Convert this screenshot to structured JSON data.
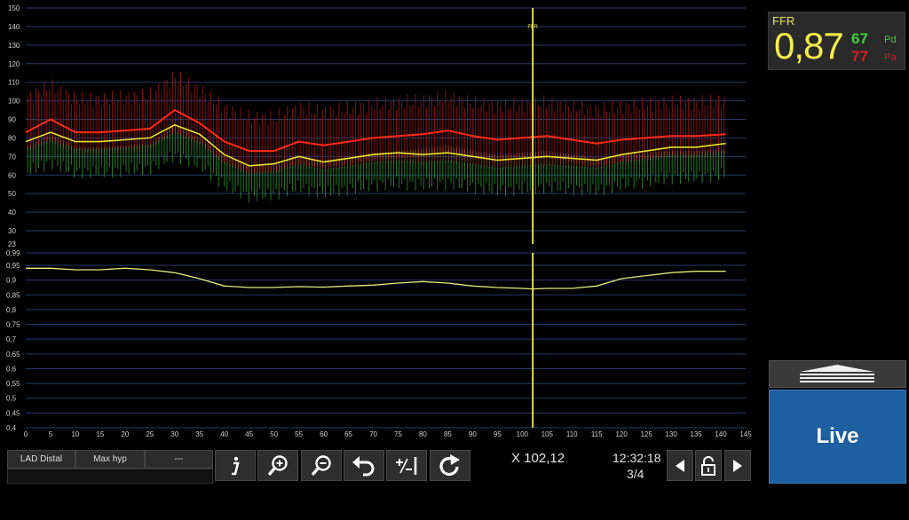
{
  "ffr": {
    "title": "FFR",
    "value": "0,87",
    "pd_value": "67",
    "pd_label": "Pd",
    "pa_value": "77",
    "pa_label": "Pa"
  },
  "live_label": "Live",
  "labels": [
    "LAD Distal",
    "Max hyp",
    "---"
  ],
  "cursor_readout": "X 102,12",
  "time": "12:32:18",
  "page": "3/4",
  "marker_label": "FFR",
  "colors": {
    "pa": "#ff2a12",
    "pd": "#e5e52a",
    "ratio": "#e8ea7a",
    "cursor": "#f4f35a",
    "grid": "#233a6a"
  },
  "chart_data": [
    {
      "type": "line",
      "title": "",
      "xlabel": "",
      "ylabel": "",
      "xlim": [
        0,
        145
      ],
      "ylim": [
        23,
        150
      ],
      "ytick_labels": [
        "150",
        "140",
        "130",
        "120",
        "110",
        "100",
        "90",
        "80",
        "70",
        "60",
        "50",
        "40",
        "30",
        "23"
      ],
      "x": [
        0,
        5,
        10,
        15,
        20,
        25,
        30,
        35,
        40,
        45,
        50,
        55,
        60,
        65,
        70,
        75,
        80,
        85,
        90,
        95,
        100,
        105,
        110,
        115,
        120,
        125,
        130,
        135,
        141
      ],
      "series": [
        {
          "values": [
            83,
            90,
            83,
            83,
            84,
            85,
            95,
            88,
            78,
            73,
            73,
            78,
            76,
            78,
            80,
            81,
            82,
            84,
            81,
            79,
            80,
            81,
            79,
            77,
            79,
            80,
            81,
            81,
            82
          ]
        },
        {
          "values": [
            78,
            83,
            78,
            78,
            79,
            80,
            87,
            82,
            71,
            65,
            66,
            70,
            67,
            69,
            71,
            72,
            71,
            72,
            70,
            68,
            69,
            70,
            69,
            68,
            71,
            73,
            75,
            75,
            77
          ]
        }
      ],
      "cursor_x": 102.12
    },
    {
      "type": "line",
      "title": "",
      "xlabel": "",
      "ylabel": "",
      "xlim": [
        0,
        145
      ],
      "ylim": [
        0.4,
        0.99
      ],
      "ytick_labels": [
        "0,99",
        "0,95",
        "0,9",
        "0,85",
        "0,8",
        "0,75",
        "0,7",
        "0,65",
        "0,6",
        "0,55",
        "0,5",
        "0,45",
        "0,4"
      ],
      "xtick_labels": [
        "0",
        "5",
        "10",
        "15",
        "20",
        "25",
        "30",
        "35",
        "40",
        "45",
        "50",
        "55",
        "60",
        "65",
        "70",
        "75",
        "80",
        "85",
        "90",
        "95",
        "100",
        "105",
        "110",
        "115",
        "120",
        "125",
        "130",
        "135",
        "140",
        "145"
      ],
      "x": [
        0,
        5,
        10,
        15,
        20,
        25,
        30,
        35,
        40,
        45,
        50,
        55,
        60,
        65,
        70,
        75,
        80,
        85,
        90,
        95,
        100,
        102,
        105,
        110,
        115,
        120,
        125,
        130,
        135,
        141
      ],
      "series": [
        {
          "values": [
            0.94,
            0.94,
            0.935,
            0.935,
            0.94,
            0.935,
            0.925,
            0.905,
            0.88,
            0.875,
            0.875,
            0.878,
            0.876,
            0.88,
            0.883,
            0.89,
            0.895,
            0.89,
            0.88,
            0.875,
            0.872,
            0.87,
            0.872,
            0.872,
            0.88,
            0.905,
            0.915,
            0.925,
            0.93,
            0.93
          ]
        }
      ],
      "cursor_x": 102.12
    }
  ]
}
